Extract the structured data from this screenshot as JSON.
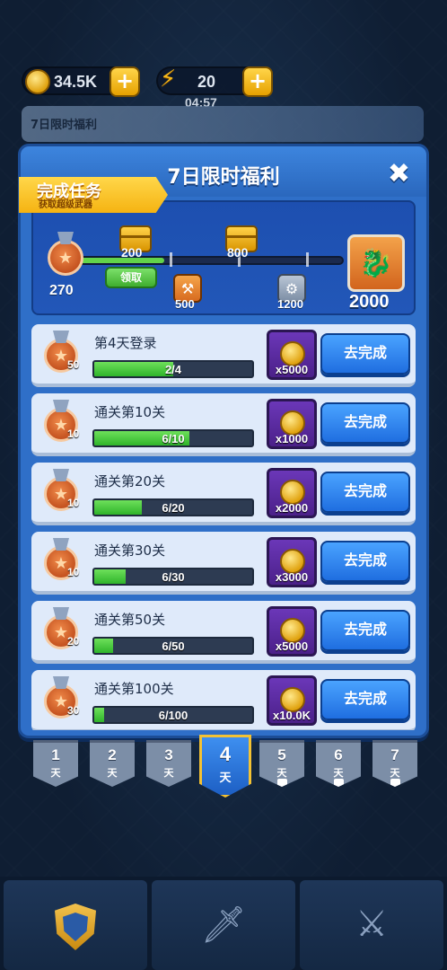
{
  "header": {
    "coins": "34.5K",
    "energy": "20",
    "timer": "04:57",
    "plus_symbol": "+"
  },
  "event_bar": {
    "label": "7日限时福利"
  },
  "dialog": {
    "title": "7日限时福利",
    "close_symbol": "✖",
    "ribbon": {
      "title": "完成任务",
      "subtitle": "获取超级武器"
    },
    "progress": {
      "current": "270",
      "fill_fraction": 0.33,
      "claim_label": "领取",
      "chests": [
        {
          "value": "200"
        },
        {
          "value": "800"
        }
      ],
      "items": [
        {
          "value": "500"
        },
        {
          "value": "1200"
        }
      ],
      "final_reward": "2000"
    },
    "tasks": [
      {
        "name": "第4天登录",
        "medal": "50",
        "progress": "2/4",
        "fraction": 0.5,
        "reward": "x5000",
        "button": "去完成"
      },
      {
        "name": "通关第10关",
        "medal": "10",
        "progress": "6/10",
        "fraction": 0.6,
        "reward": "x1000",
        "button": "去完成"
      },
      {
        "name": "通关第20关",
        "medal": "10",
        "progress": "6/20",
        "fraction": 0.3,
        "reward": "x2000",
        "button": "去完成"
      },
      {
        "name": "通关第30关",
        "medal": "10",
        "progress": "6/30",
        "fraction": 0.2,
        "reward": "x3000",
        "button": "去完成"
      },
      {
        "name": "通关第50关",
        "medal": "20",
        "progress": "6/50",
        "fraction": 0.12,
        "reward": "x5000",
        "button": "去完成"
      },
      {
        "name": "通关第100关",
        "medal": "30",
        "progress": "6/100",
        "fraction": 0.06,
        "reward": "x10.0K",
        "button": "去完成"
      }
    ]
  },
  "days": [
    {
      "num": "1",
      "unit": "天",
      "locked": false,
      "active": false
    },
    {
      "num": "2",
      "unit": "天",
      "locked": false,
      "active": false
    },
    {
      "num": "3",
      "unit": "天",
      "locked": false,
      "active": false
    },
    {
      "num": "4",
      "unit": "天",
      "locked": false,
      "active": true
    },
    {
      "num": "5",
      "unit": "天",
      "locked": true,
      "active": false
    },
    {
      "num": "6",
      "unit": "天",
      "locked": true,
      "active": false
    },
    {
      "num": "7",
      "unit": "天",
      "locked": true,
      "active": false
    }
  ],
  "icons": {
    "coin": "coin-icon",
    "energy": "lightning-icon",
    "star": "★",
    "final_weapon": "dragon-weapon-icon",
    "sword": "sword-icon",
    "shield": "shield-icon",
    "locked_armory": "locked-armory-icon"
  },
  "colors": {
    "dialog_blue": "#2f6fc8",
    "progress_green": "#62d44a",
    "go_button": "#1f6ee0",
    "ribbon_gold": "#f5b312"
  }
}
